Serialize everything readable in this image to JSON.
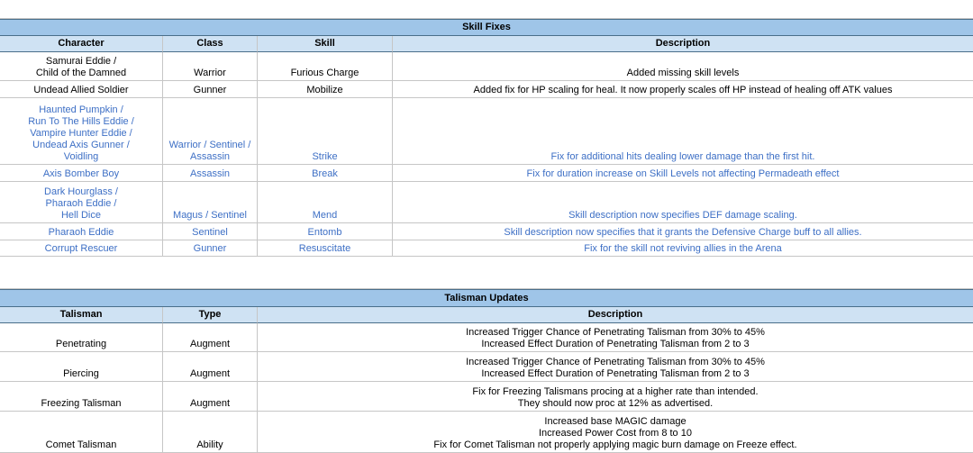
{
  "skill_fixes": {
    "title": "Skill Fixes",
    "headers": [
      "Character",
      "Class",
      "Skill",
      "Description"
    ],
    "rows": [
      {
        "character": "Samurai Eddie /\nChild of the Damned",
        "class": "Warrior",
        "skill": "Furious Charge",
        "description": "Added missing skill levels"
      },
      {
        "character": "Undead Allied Soldier",
        "class": "Gunner",
        "skill": "Mobilize",
        "description": "Added fix for HP scaling for heal. It now properly scales off HP instead of healing off ATK values"
      },
      {
        "character": "Haunted Pumpkin /\nRun To The Hills Eddie /\nVampire Hunter Eddie /\nUndead Axis Gunner /\nVoidling",
        "class": "Warrior / Sentinel /\nAssassin",
        "skill": "Strike",
        "description": "Fix for additional hits dealing lower damage than the first hit."
      },
      {
        "character": "Axis Bomber Boy",
        "class": "Assassin",
        "skill": "Break",
        "description": "Fix for duration increase on Skill Levels not affecting Permadeath effect"
      },
      {
        "character": "Dark Hourglass /\nPharaoh Eddie /\nHell Dice",
        "class": "Magus / Sentinel",
        "skill": "Mend",
        "description": "Skill description now specifies DEF damage scaling."
      },
      {
        "character": "Pharaoh Eddie",
        "class": "Sentinel",
        "skill": "Entomb",
        "description": "Skill description now specifies that it grants the Defensive Charge buff to all allies."
      },
      {
        "character": "Corrupt Rescuer",
        "class": "Gunner",
        "skill": "Resuscitate",
        "description": "Fix for the skill not reviving allies in the Arena"
      }
    ]
  },
  "talisman_updates": {
    "title": "Talisman Updates",
    "headers": [
      "Talisman",
      "Type",
      "Description"
    ],
    "rows": [
      {
        "talisman": "Penetrating",
        "type": "Augment",
        "description": "Increased Trigger Chance of Penetrating Talisman from 30% to 45%\nIncreased Effect Duration of Penetrating Talisman from 2 to 3"
      },
      {
        "talisman": "Piercing",
        "type": "Augment",
        "description": "Increased Trigger Chance of Penetrating Talisman from 30% to 45%\nIncreased Effect Duration of Penetrating Talisman from 2 to 3"
      },
      {
        "talisman": "Freezing Talisman",
        "type": "Augment",
        "description": "Fix for Freezing Talismans procing at a higher rate than intended.\nThey should now proc at 12% as advertised."
      },
      {
        "talisman": "Comet Talisman",
        "type": "Ability",
        "description": "Increased base MAGIC damage\nIncreased Power Cost from 8 to 10\nFix for Comet Talisman not properly applying magic burn damage on Freeze effect."
      }
    ]
  },
  "colors": {
    "title_bg": "#9fc5e8",
    "header_bg": "#cfe2f3",
    "blue_text": "#3d6fc5"
  }
}
